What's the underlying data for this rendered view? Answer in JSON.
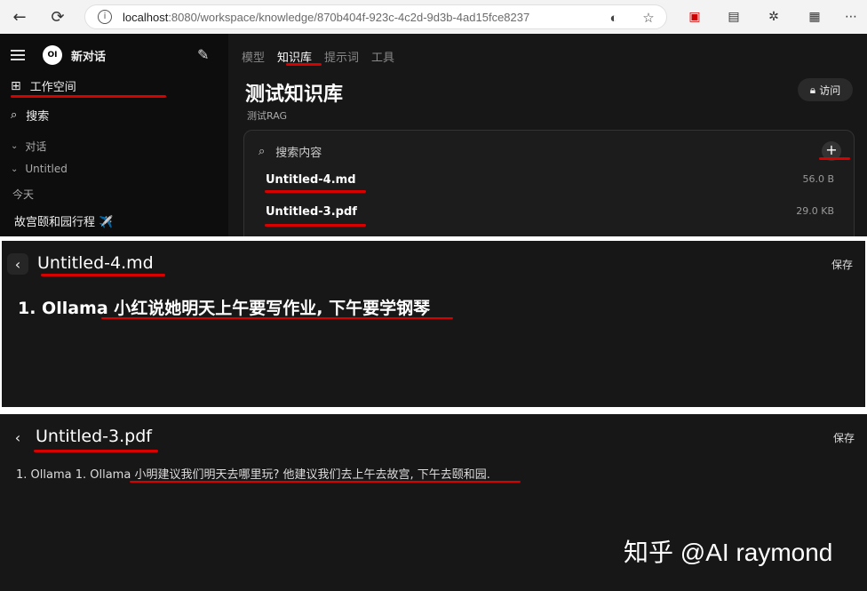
{
  "browser": {
    "url_host": "localhost",
    "url_path": ":8080/workspace/knowledge/870b404f-923c-4c2d-9d3b-4ad15fce8237"
  },
  "sidebar": {
    "logo_text": "OI",
    "new_chat": "新对话",
    "workspace": "工作空间",
    "search": "搜索",
    "sections": [
      "对话",
      "Untitled"
    ],
    "today": "今天",
    "recent_chat": "故宫颐和园行程 ✈️"
  },
  "main": {
    "tabs": [
      {
        "label": "模型",
        "active": false
      },
      {
        "label": "知识库",
        "active": true
      },
      {
        "label": "提示词",
        "active": false
      },
      {
        "label": "工具",
        "active": false
      }
    ],
    "title": "测试知识库",
    "subtitle": "测试RAG",
    "visit_button": "访问",
    "search_placeholder": "搜索内容",
    "files": [
      {
        "name": "Untitled-4.md",
        "size": "56.0 B"
      },
      {
        "name": "Untitled-3.pdf",
        "size": "29.0 KB"
      }
    ]
  },
  "editor_md": {
    "title": "Untitled-4.md",
    "save": "保存",
    "content": "1. Ollama 小红说她明天上午要写作业, 下午要学钢琴"
  },
  "editor_pdf": {
    "title": "Untitled-3.pdf",
    "save": "保存",
    "content": "1. Ollama 1. Ollama 小明建议我们明天去哪里玩? 他建议我们去上午去故宫, 下午去颐和园."
  },
  "watermark": "知乎 @AI raymond",
  "colors": {
    "app_bg": "#171717",
    "sidebar_bg": "#0d0d0d",
    "annotation_red": "#d90000"
  }
}
